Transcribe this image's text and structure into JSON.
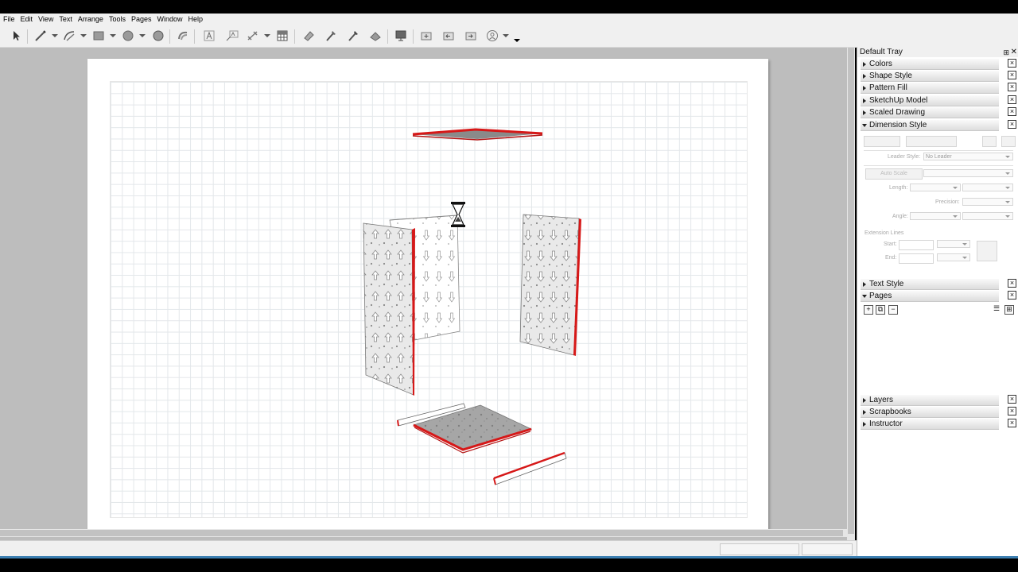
{
  "menu": [
    "File",
    "Edit",
    "View",
    "Text",
    "Arrange",
    "Tools",
    "Pages",
    "Window",
    "Help"
  ],
  "toolbar_icons": [
    "select-icon",
    "line-icon",
    "arc-icon",
    "rectangle-icon",
    "circle-icon",
    "polygon-icon",
    "offset-icon",
    "text-icon",
    "label-icon",
    "dimension-icon",
    "table-icon",
    "eraser-icon",
    "style-icon",
    "sample-icon",
    "split-icon",
    "presentation-icon",
    "add-page-icon",
    "previous-page-icon",
    "next-page-icon",
    "account-icon"
  ],
  "tray": {
    "title": "Default Tray",
    "panels_top": [
      {
        "label": "Colors",
        "open": false
      },
      {
        "label": "Shape Style",
        "open": false
      },
      {
        "label": "Pattern Fill",
        "open": false
      },
      {
        "label": "SketchUp Model",
        "open": false
      },
      {
        "label": "Scaled Drawing",
        "open": false
      },
      {
        "label": "Dimension Style",
        "open": true
      }
    ],
    "dimension_style": {
      "leader_style_label": "Leader Style:",
      "leader_style_value": "No Leader",
      "auto_scale": "Auto Scale",
      "length_label": "Length:",
      "precision_label": "Precision:",
      "angle_label": "Angle:",
      "extension_lines": "Extension Lines",
      "start_label": "Start:",
      "end_label": "End:"
    },
    "panels_mid": [
      {
        "label": "Text Style",
        "open": false
      },
      {
        "label": "Pages",
        "open": true
      }
    ],
    "panels_bottom": [
      {
        "label": "Layers",
        "open": false
      },
      {
        "label": "Scrapbooks",
        "open": false
      },
      {
        "label": "Instructor",
        "open": false
      }
    ]
  },
  "colors": {
    "edge_red": "#d61818",
    "panel_fill": "#e8e8e8",
    "accent_blue": "#3c7fb1"
  }
}
